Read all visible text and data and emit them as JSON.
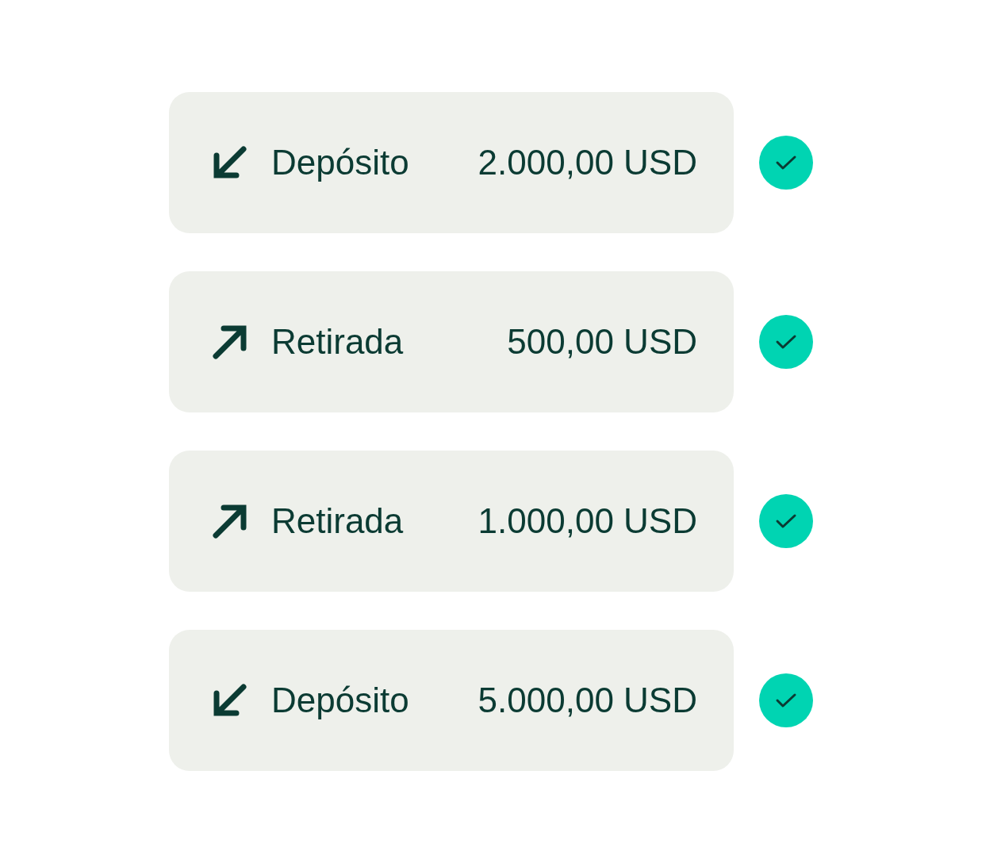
{
  "transactions": [
    {
      "kind": "deposit",
      "label": "Depósito",
      "amount": "2.000,00 USD",
      "completed": true
    },
    {
      "kind": "withdrawal",
      "label": "Retirada",
      "amount": "500,00 USD",
      "completed": true
    },
    {
      "kind": "withdrawal",
      "label": "Retirada",
      "amount": "1.000,00 USD",
      "completed": true
    },
    {
      "kind": "deposit",
      "label": "Depósito",
      "amount": "5.000,00 USD",
      "completed": true
    }
  ]
}
